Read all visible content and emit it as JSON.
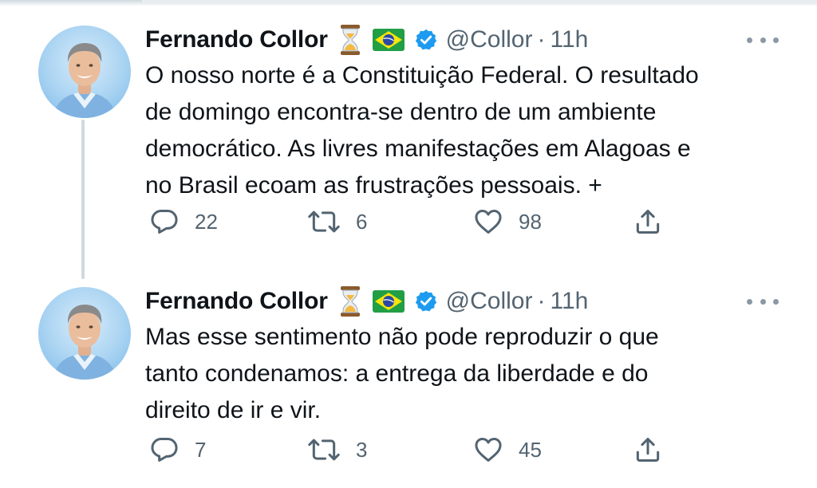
{
  "tweets": [
    {
      "author_name": "Fernando Collor",
      "emojis": [
        "hourglass-icon",
        "brazil-flag-icon"
      ],
      "verified": true,
      "handle": "@Collor",
      "separator": "·",
      "time": "11h",
      "text_lines": [
        "O nosso norte é a Constituição Federal. O resultado",
        "de domingo encontra-se dentro de um ambiente",
        "democrático. As livres manifestações em Alagoas e",
        "no Brasil ecoam as frustrações pessoais. +"
      ],
      "replies": "22",
      "retweets": "6",
      "likes": "98"
    },
    {
      "author_name": "Fernando Collor",
      "emojis": [
        "hourglass-icon",
        "brazil-flag-icon"
      ],
      "verified": true,
      "handle": "@Collor",
      "separator": "·",
      "time": "11h",
      "text_lines": [
        "Mas esse sentimento não pode reproduzir o que",
        "tanto condenamos: a entrega da liberdade e do",
        "direito de ir e vir."
      ],
      "replies": "7",
      "retweets": "3",
      "likes": "45"
    }
  ],
  "colors": {
    "text": "#0f1419",
    "secondary": "#536471",
    "verified_blue": "#1d9bf0",
    "thread_line": "#cfd9de"
  }
}
